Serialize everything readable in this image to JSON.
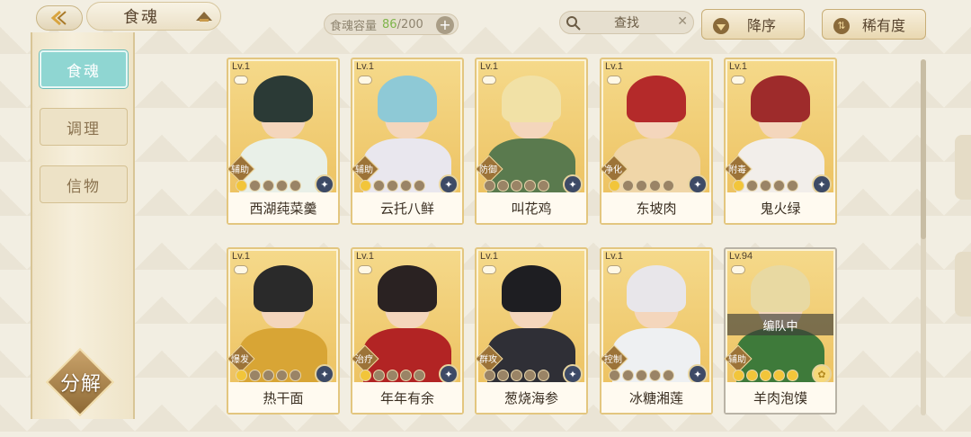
{
  "header": {
    "title": "食魂",
    "capacity_label": "食魂容量",
    "capacity_current": "86",
    "capacity_max": "/200",
    "capacity_plus": "+",
    "search_label": "查找",
    "search_clear": "✕",
    "sort_label": "降序",
    "rarity_label": "稀有度",
    "rarity_icon": "⇅"
  },
  "sidebar": {
    "tabs": [
      {
        "label": "食魂",
        "active": true
      },
      {
        "label": "调理",
        "active": false
      },
      {
        "label": "信物",
        "active": false
      }
    ],
    "decompose_label": "分解"
  },
  "cards": [
    {
      "level": "Lv.1",
      "role": "辅助",
      "name": "西湖莼菜羹",
      "stars": 5,
      "gold_stars": 1,
      "hair": "#2b3a36",
      "outfit": "#e9f0e8",
      "badge": "✦",
      "gray": false,
      "in_team": ""
    },
    {
      "level": "Lv.1",
      "role": "辅助",
      "name": "云托八鲜",
      "stars": 5,
      "gold_stars": 1,
      "hair": "#8ec9d6",
      "outfit": "#e9e7ee",
      "badge": "✦",
      "gray": false,
      "in_team": ""
    },
    {
      "level": "Lv.1",
      "role": "防御",
      "name": "叫花鸡",
      "stars": 5,
      "gold_stars": 0,
      "hair": "#f1e1a6",
      "outfit": "#5a7a4e",
      "badge": "✦",
      "gray": false,
      "in_team": ""
    },
    {
      "level": "Lv.1",
      "role": "净化",
      "name": "东坡肉",
      "stars": 5,
      "gold_stars": 1,
      "hair": "#b42a2a",
      "outfit": "#f0d6a8",
      "badge": "✦",
      "gray": false,
      "in_team": ""
    },
    {
      "level": "Lv.1",
      "role": "附毒",
      "name": "鬼火绿",
      "stars": 5,
      "gold_stars": 1,
      "hair": "#9e2b2b",
      "outfit": "#f2eeea",
      "badge": "✦",
      "gray": false,
      "in_team": ""
    },
    {
      "level": "Lv.1",
      "role": "爆发",
      "name": "热干面",
      "stars": 5,
      "gold_stars": 1,
      "hair": "#2a2a2a",
      "outfit": "#d8a535",
      "badge": "✦",
      "gray": false,
      "in_team": ""
    },
    {
      "level": "Lv.1",
      "role": "治疗",
      "name": "年年有余",
      "stars": 5,
      "gold_stars": 1,
      "hair": "#2a2222",
      "outfit": "#b22424",
      "badge": "✦",
      "gray": false,
      "in_team": ""
    },
    {
      "level": "Lv.1",
      "role": "群攻",
      "name": "葱烧海参",
      "stars": 5,
      "gold_stars": 0,
      "hair": "#1e1e22",
      "outfit": "#2f2f36",
      "badge": "✦",
      "gray": false,
      "in_team": ""
    },
    {
      "level": "Lv.1",
      "role": "控制",
      "name": "冰糖湘莲",
      "stars": 5,
      "gold_stars": 0,
      "hair": "#e8e6ea",
      "outfit": "#eef0f2",
      "badge": "✦",
      "gray": false,
      "in_team": ""
    },
    {
      "level": "Lv.94",
      "role": "辅助",
      "name": "羊肉泡馍",
      "stars": 5,
      "gold_stars": 5,
      "hair": "#e8d9a2",
      "outfit": "#3e7a3a",
      "badge": "✿",
      "gray": true,
      "in_team": "编队中"
    }
  ]
}
